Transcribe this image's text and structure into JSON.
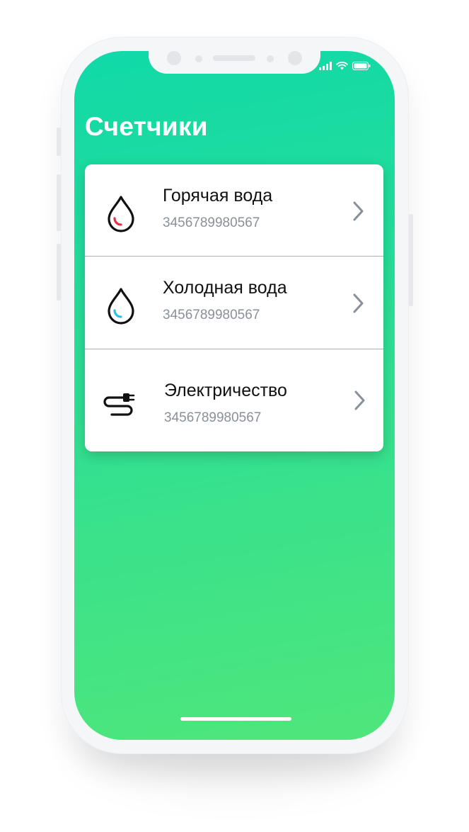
{
  "screen": {
    "title": "Счетчики"
  },
  "status_bar": {
    "signal_icon": "cellular-signal-icon",
    "wifi_icon": "wifi-icon",
    "battery_icon": "battery-icon"
  },
  "meters": [
    {
      "name": "Горячая вода",
      "number": "3456789980567",
      "icon": "hot-water-drop-icon",
      "accent": "#e8304a"
    },
    {
      "name": "Холодная вода",
      "number": "3456789980567",
      "icon": "cold-water-drop-icon",
      "accent": "#27c3e6"
    },
    {
      "name": "Электричество",
      "number": "3456789980567",
      "icon": "electric-plug-icon",
      "accent": "#111111"
    }
  ],
  "colors": {
    "gradient_top": "#10d9a8",
    "gradient_bottom": "#4fe67b",
    "chevron": "#8a9099"
  }
}
